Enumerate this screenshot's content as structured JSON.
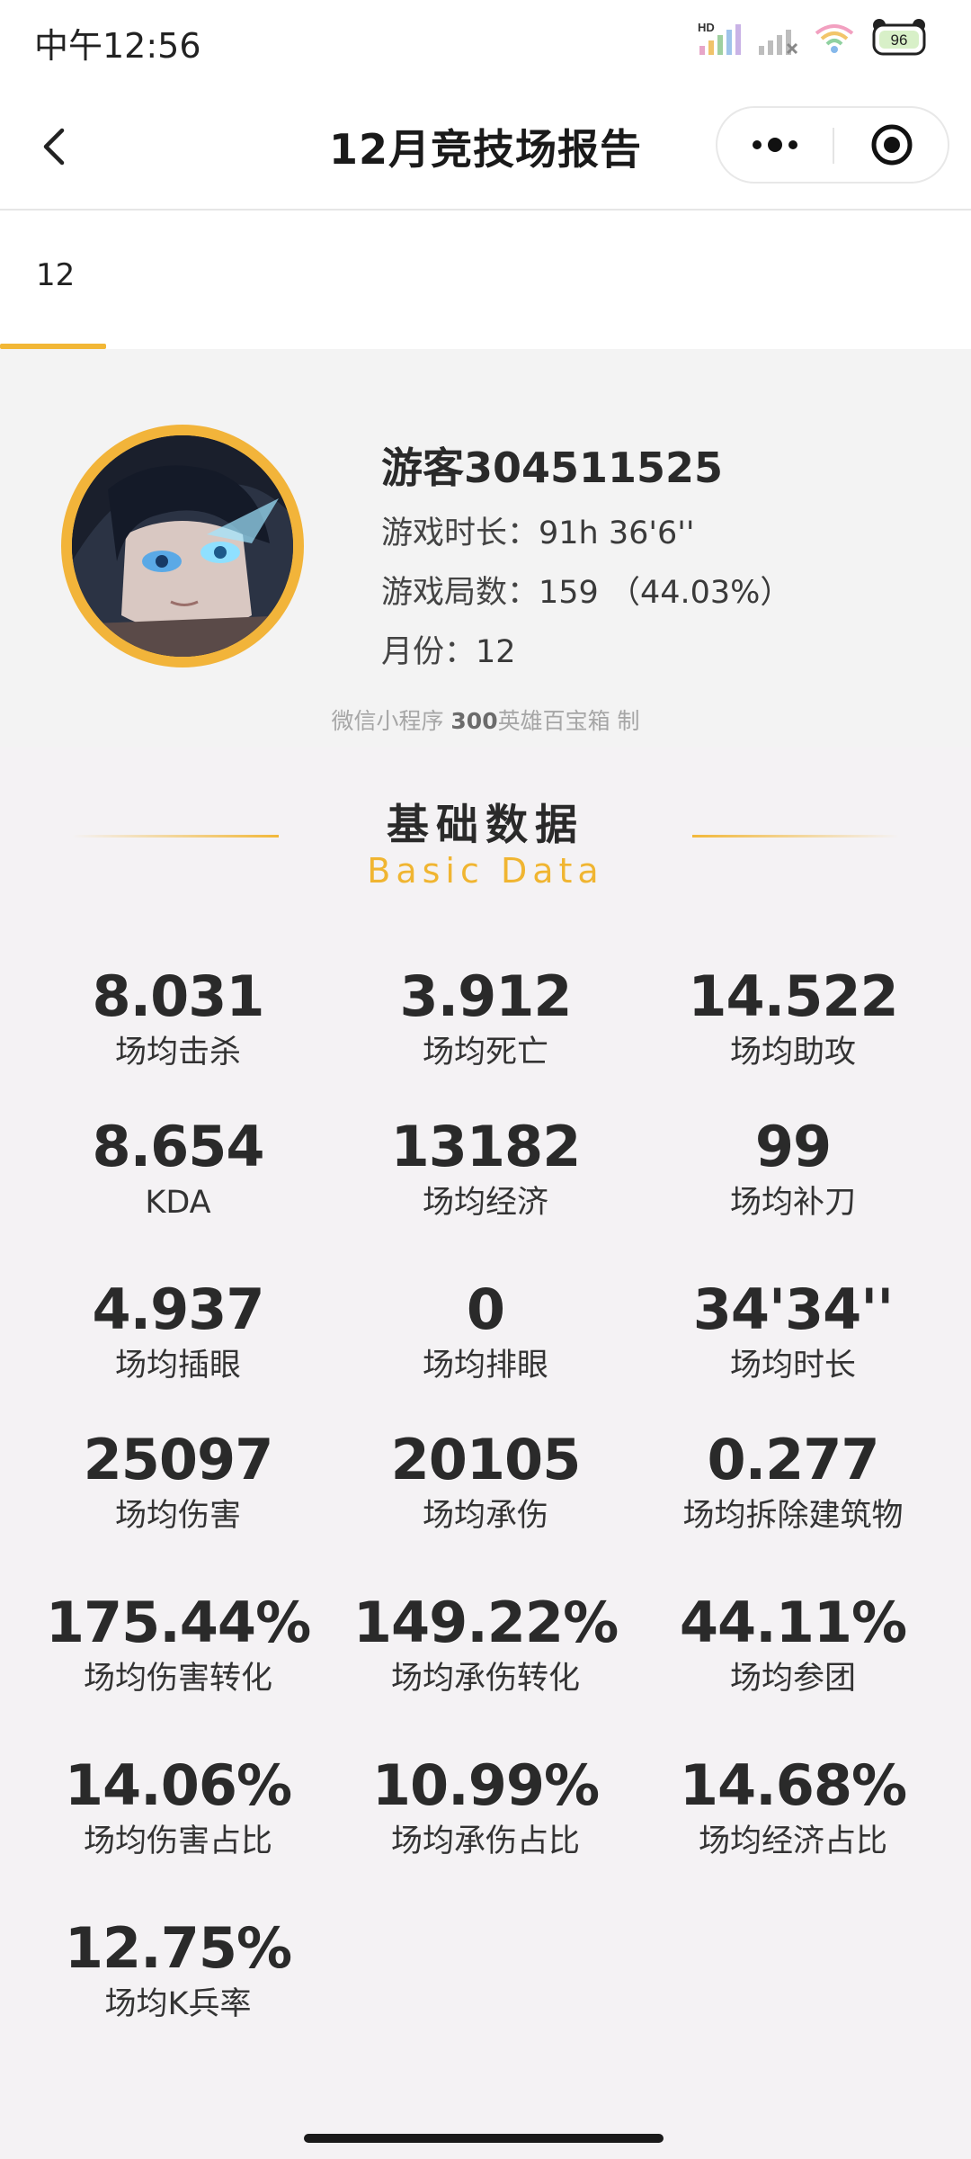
{
  "status_bar": {
    "time": "中午12:56",
    "network_badge": "HD",
    "battery_level": "96"
  },
  "nav": {
    "title": "12月竞技场报告"
  },
  "tabs": [
    {
      "label": "12",
      "active": true
    }
  ],
  "profile": {
    "name": "游客304511525",
    "play_time_label": "游戏时长：",
    "play_time_value": "91h 36'6''",
    "games_label": "游戏局数：",
    "games_value": "159 （44.03%）",
    "month_label": "月份：",
    "month_value": "12",
    "watermark_prefix": "微信小程序 ",
    "watermark_bold": "300",
    "watermark_suffix": "英雄百宝箱 制"
  },
  "section": {
    "title": "基础数据",
    "subtitle": "Basic Data"
  },
  "stats": [
    {
      "value": "8.031",
      "label": "场均击杀"
    },
    {
      "value": "3.912",
      "label": "场均死亡"
    },
    {
      "value": "14.522",
      "label": "场均助攻"
    },
    {
      "value": "8.654",
      "label": "KDA"
    },
    {
      "value": "13182",
      "label": "场均经济"
    },
    {
      "value": "99",
      "label": "场均补刀"
    },
    {
      "value": "4.937",
      "label": "场均插眼"
    },
    {
      "value": "0",
      "label": "场均排眼"
    },
    {
      "value": "34'34''",
      "label": "场均时长"
    },
    {
      "value": "25097",
      "label": "场均伤害"
    },
    {
      "value": "20105",
      "label": "场均承伤"
    },
    {
      "value": "0.277",
      "label": "场均拆除建筑物"
    },
    {
      "value": "175.44%",
      "label": "场均伤害转化"
    },
    {
      "value": "149.22%",
      "label": "场均承伤转化"
    },
    {
      "value": "44.11%",
      "label": "场均参团"
    },
    {
      "value": "14.06%",
      "label": "场均伤害占比"
    },
    {
      "value": "10.99%",
      "label": "场均承伤占比"
    },
    {
      "value": "14.68%",
      "label": "场均经济占比"
    },
    {
      "value": "12.75%",
      "label": "场均K兵率"
    }
  ],
  "colors": {
    "accent": "#f2b736",
    "text": "#2a2a2a",
    "background": "#f4f2f4"
  }
}
